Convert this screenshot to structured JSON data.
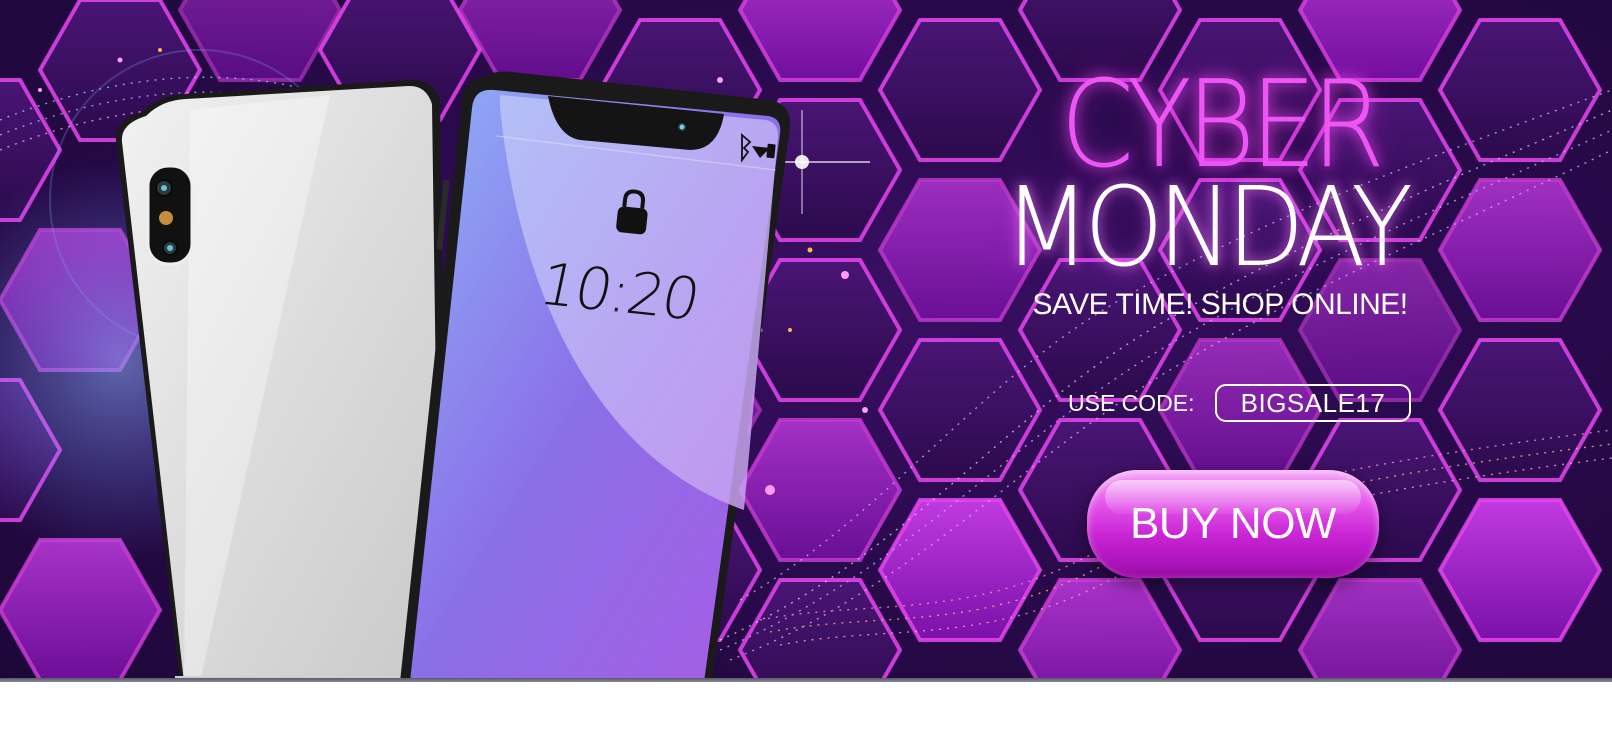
{
  "banner": {
    "title_line1": "CYBER",
    "title_line2": "MONDAY",
    "tagline": "SAVE TIME! SHOP ONLINE!",
    "code_label": "USE CODE:",
    "code_value": "BIGSALE17",
    "cta_label": "BUY NOW"
  },
  "phone_front": {
    "clock": "10:20",
    "status_icons": [
      "bluetooth-icon",
      "wifi-icon",
      "battery-icon"
    ],
    "lock_icon": "padlock-icon"
  },
  "colors": {
    "background_dark": "#2a0a4e",
    "hexagon_magenta": "#b322d6",
    "hexagon_border": "#e845f0",
    "title_pink": "#ee55f5",
    "button_magenta": "#d633e0",
    "screen_blue": "#7da3f4",
    "screen_purple": "#a960e6"
  }
}
